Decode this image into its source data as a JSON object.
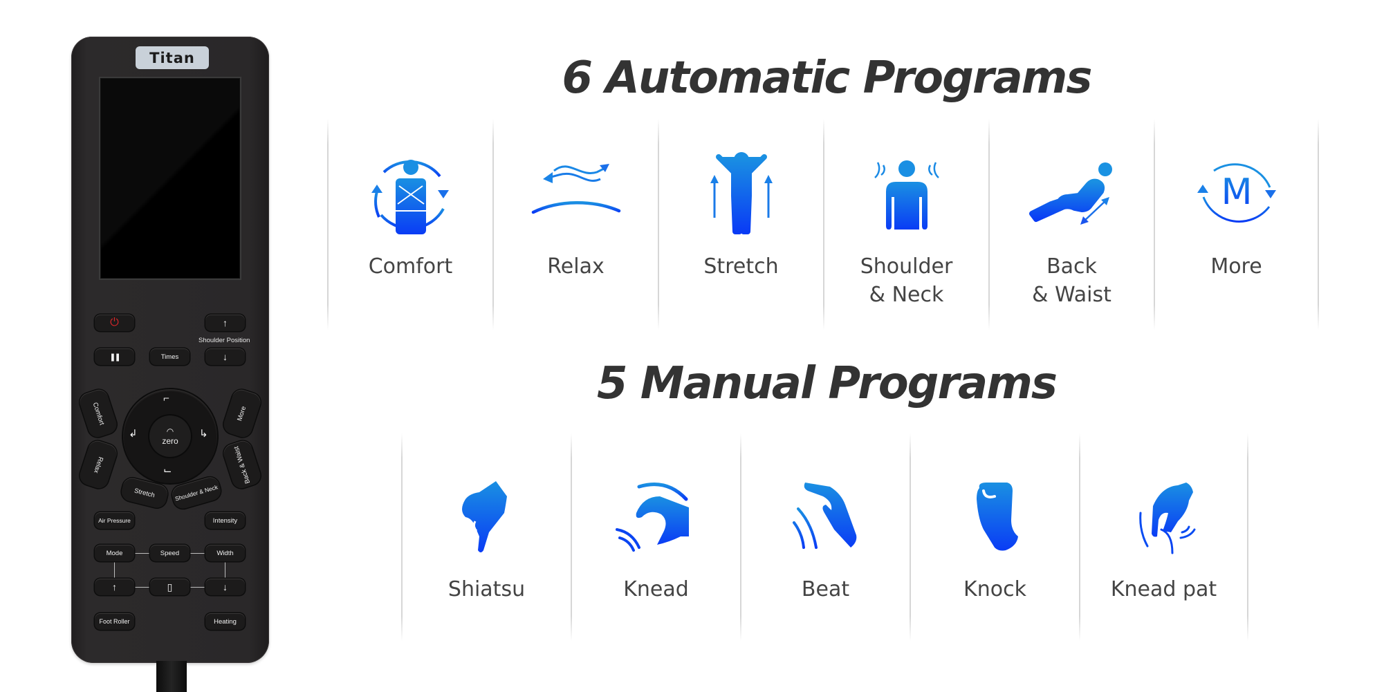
{
  "remote": {
    "brand": "Titan",
    "buttons": {
      "power_icon": "⏻",
      "pause_icon": "❚❚",
      "times": "Times",
      "shoulder_up_icon": "↑",
      "shoulder_down_icon": "↓",
      "shoulder_position": "Shoulder Position",
      "comfort": "Comfort",
      "relax": "Relax",
      "stretch": "Stretch",
      "shoulder_neck": "Shoulder & Neck",
      "back_waist": "Back & Waist",
      "more": "More",
      "zero": "zero",
      "air_pressure": "Air Pressure",
      "intensity": "Intensity",
      "mode": "Mode",
      "speed": "Speed",
      "width": "Width",
      "up_icon": "↑",
      "roller_icon": "▯",
      "down_icon": "↓",
      "foot_roller": "Foot Roller",
      "heating": "Heating"
    }
  },
  "automatic": {
    "title": "6 Automatic Programs",
    "programs": [
      {
        "label_line1": "Comfort",
        "label_line2": "",
        "icon": "comfort-icon"
      },
      {
        "label_line1": "Relax",
        "label_line2": "",
        "icon": "relax-icon"
      },
      {
        "label_line1": "Stretch",
        "label_line2": "",
        "icon": "stretch-icon"
      },
      {
        "label_line1": "Shoulder",
        "label_line2": "& Neck",
        "icon": "shoulder-neck-icon"
      },
      {
        "label_line1": "Back",
        "label_line2": "& Waist",
        "icon": "back-waist-icon"
      },
      {
        "label_line1": "More",
        "label_line2": "",
        "icon": "more-icon"
      }
    ]
  },
  "manual": {
    "title": "5 Manual Programs",
    "programs": [
      {
        "label": "Shiatsu",
        "icon": "shiatsu-hand-icon"
      },
      {
        "label": "Knead",
        "icon": "knead-hand-icon"
      },
      {
        "label": "Beat",
        "icon": "beat-hand-icon"
      },
      {
        "label": "Knock",
        "icon": "knock-fist-icon"
      },
      {
        "label": "Knead pat",
        "icon": "knead-pat-hand-icon"
      }
    ]
  },
  "colors": {
    "icon_gradient_top": "#1a90e2",
    "icon_gradient_bottom": "#0a3cf5",
    "heading": "#333333",
    "label": "#444444",
    "remote_body": "#2a2829",
    "power_red": "#d8262a"
  }
}
